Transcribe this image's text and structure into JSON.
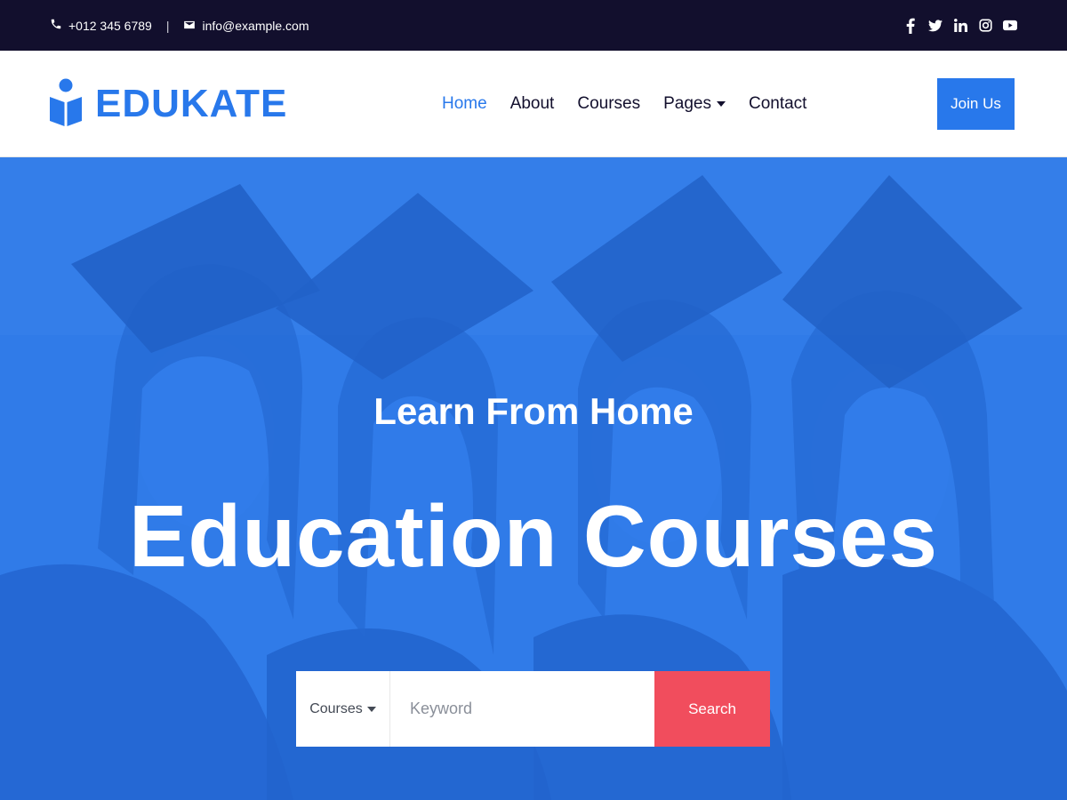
{
  "topbar": {
    "phone": "+012 345 6789",
    "separator": "|",
    "email": "info@example.com",
    "social_icons": [
      "facebook-icon",
      "twitter-icon",
      "linkedin-icon",
      "instagram-icon",
      "youtube-icon"
    ]
  },
  "brand": {
    "name": "EDUKATE",
    "color": "#2878eb"
  },
  "nav": {
    "items": [
      {
        "label": "Home",
        "active": true
      },
      {
        "label": "About",
        "active": false
      },
      {
        "label": "Courses",
        "active": false
      },
      {
        "label": "Pages",
        "active": false,
        "dropdown": true
      },
      {
        "label": "Contact",
        "active": false
      }
    ],
    "cta_label": "Join Us"
  },
  "hero": {
    "subtitle": "Learn From Home",
    "title": "Education Courses"
  },
  "search": {
    "category_selected": "Courses",
    "keyword_placeholder": "Keyword",
    "button_label": "Search"
  },
  "colors": {
    "topbar_bg": "#120f2d",
    "primary": "#2878eb",
    "search_button": "#f14d5d"
  }
}
